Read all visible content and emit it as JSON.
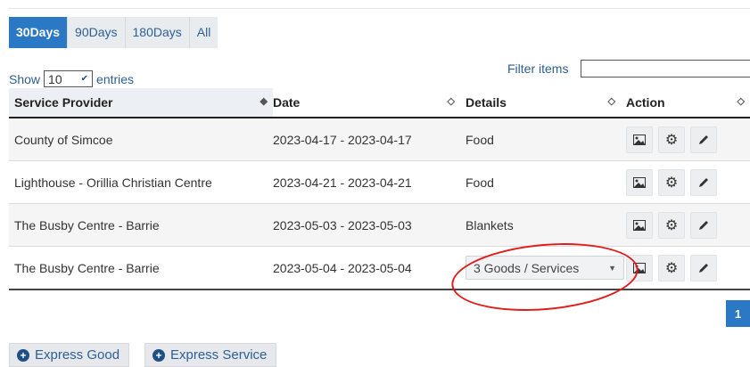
{
  "range_tabs": [
    {
      "label": "30Days",
      "active": true
    },
    {
      "label": "90Days",
      "active": false
    },
    {
      "label": "180Days",
      "active": false
    },
    {
      "label": "All",
      "active": false
    }
  ],
  "length_control": {
    "prefix": "Show",
    "value": "10",
    "suffix": "entries"
  },
  "filter": {
    "label": "Filter items",
    "value": ""
  },
  "table": {
    "headers": [
      "Service Provider",
      "Date",
      "Details",
      "Action"
    ],
    "rows": [
      {
        "provider": "County of Simcoe",
        "date": "2023-04-17 - 2023-04-17",
        "details": "Food",
        "details_is_select": false
      },
      {
        "provider": "Lighthouse - Orillia Christian Centre",
        "date": "2023-04-21 - 2023-04-21",
        "details": "Food",
        "details_is_select": false
      },
      {
        "provider": "The Busby Centre - Barrie",
        "date": "2023-05-03 - 2023-05-03",
        "details": "Blankets",
        "details_is_select": false
      },
      {
        "provider": "The Busby Centre - Barrie",
        "date": "2023-05-04 - 2023-05-04",
        "details": "3 Goods / Services",
        "details_is_select": true
      }
    ]
  },
  "pagination": {
    "current": "1"
  },
  "buttons": {
    "express_good": "Express Good",
    "express_service": "Express Service"
  },
  "colors": {
    "accent": "#2b78c4",
    "highlight": "#e01c1c"
  }
}
